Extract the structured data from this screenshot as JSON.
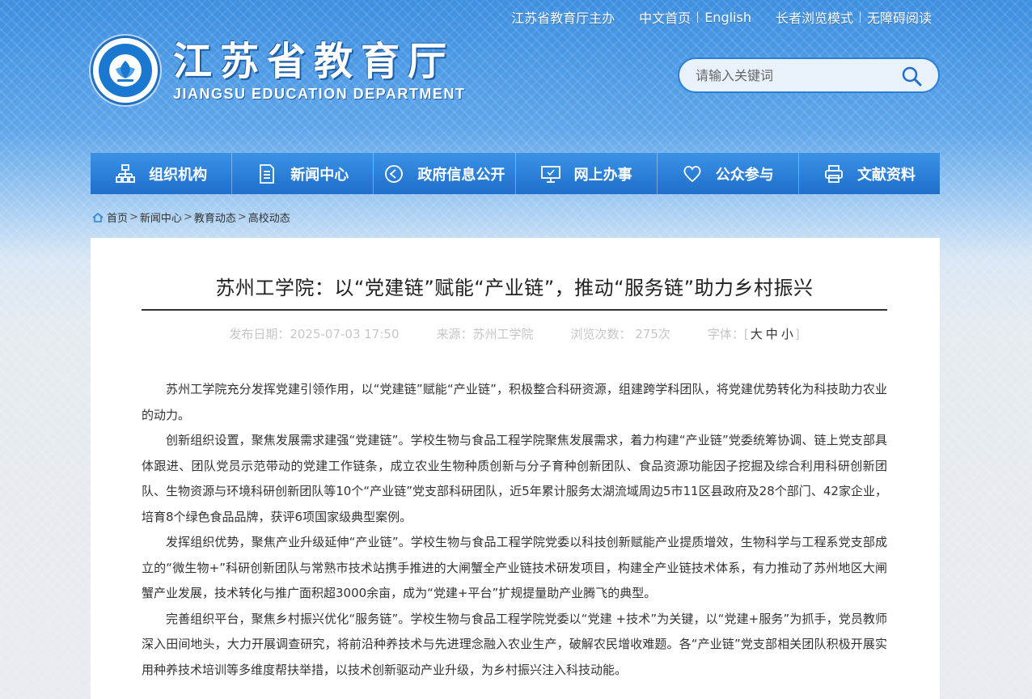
{
  "header": {
    "top_links": {
      "host": "江苏省教育厅主办",
      "home_cn": "中文首页",
      "english": "English",
      "elder_mode": "长者浏览模式",
      "accessible": "无障碍阅读"
    },
    "brand_cn": "江苏省教育厅",
    "brand_en": "JIANGSU EDUCATION DEPARTMENT",
    "search_placeholder": "请输入关键词"
  },
  "nav": {
    "items": [
      {
        "label": "组织机构",
        "icon": "org-chart-icon"
      },
      {
        "label": "新闻中心",
        "icon": "document-icon"
      },
      {
        "label": "政府信息公开",
        "icon": "play-circle-icon"
      },
      {
        "label": "网上办事",
        "icon": "monitor-icon"
      },
      {
        "label": "公众参与",
        "icon": "heart-icon"
      },
      {
        "label": "文献资料",
        "icon": "printer-icon"
      }
    ]
  },
  "breadcrumb": {
    "home": "首页",
    "level1": "新闻中心",
    "level2": "教育动态",
    "level3": "高校动态",
    "arrow": ">"
  },
  "article": {
    "title": "苏州工学院：以“党建链”赋能“产业链”，推动“服务链”助力乡村振兴",
    "meta": {
      "date": "发布日期：2025-07-03 17:50",
      "source": "来源：苏州工学院",
      "views": "浏览次数：  275次",
      "font_label": "字体：",
      "font_large": "大",
      "font_medium": "中",
      "font_small": "小"
    },
    "paragraphs": [
      "苏州工学院充分发挥党建引领作用，以“党建链”赋能“产业链”，积极整合科研资源，组建跨学科团队，将党建优势转化为科技助力农业的动力。",
      "创新组织设置，聚焦发展需求建强“党建链”。学校生物与食品工程学院聚焦发展需求，着力构建“产业链”党委统筹协调、链上党支部具体跟进、团队党员示范带动的党建工作链条，成立农业生物种质创新与分子育种创新团队、食品资源功能因子挖掘及综合利用科研创新团队、生物资源与环境科研创新团队等10个“产业链”党支部科研团队，近5年累计服务太湖流域周边5市11区县政府及28个部门、42家企业，培育8个绿色食品品牌，获评6项国家级典型案例。",
      "发挥组织优势，聚焦产业升级延伸“产业链”。学校生物与食品工程学院党委以科技创新赋能产业提质增效，生物科学与工程系党支部成立的“微生物+”科研创新团队与常熟市技术站携手推进的大闸蟹全产业链技术研发项目，构建全产业链技术体系，有力推动了苏州地区大闸蟹产业发展，技术转化与推广面积超3000余亩，成为“党建+平台”扩规提量助产业腾飞的典型。",
      "完善组织平台，聚焦乡村振兴优化“服务链”。学校生物与食品工程学院党委以“党建 +技术”为关键，以“党建+服务”为抓手，党员教师深入田间地头，大力开展调查研究，将前沿种养技术与先进理念融入农业生产，破解农民增收难题。各“产业链”党支部相关团队积极开展实用种养技术培训等多维度帮扶举措，以技术创新驱动产业升级，为乡村振兴注入科技动能。"
    ]
  },
  "colors": {
    "nav_top": "#3a92e6",
    "nav_bottom": "#1f6fcb",
    "search_border": "#2a7fd6"
  }
}
